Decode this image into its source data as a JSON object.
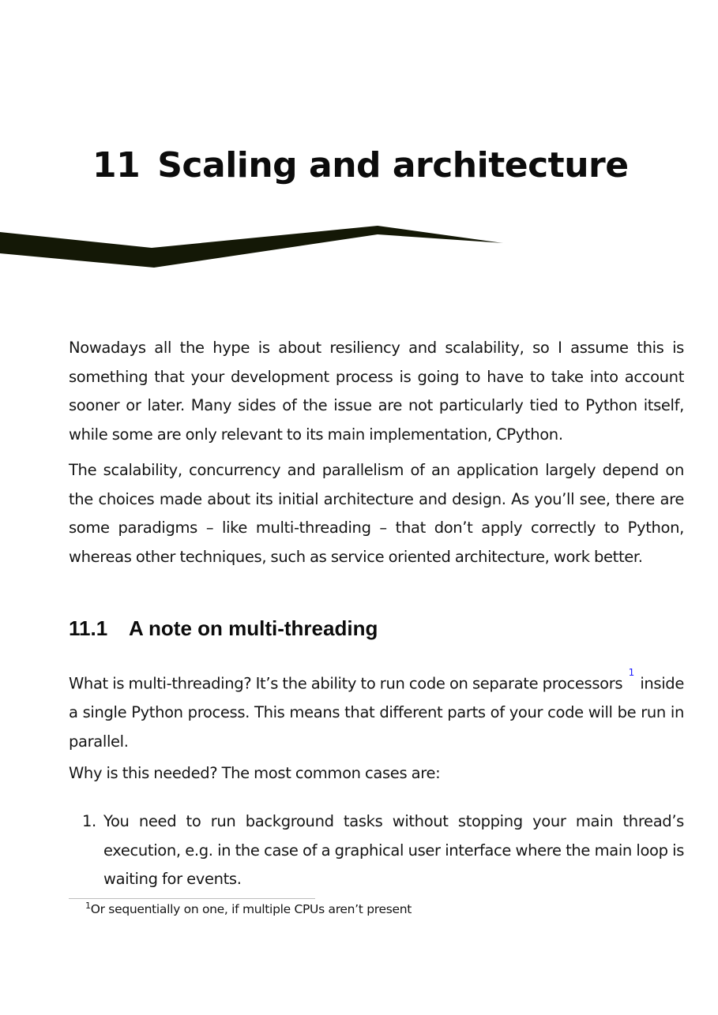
{
  "chapter": {
    "number": "11",
    "title": "Scaling and architecture"
  },
  "intro": {
    "p1": "Nowadays all the hype is about resiliency and scalability, so I assume this is something that your development process is going to have to take into account sooner or later. Many sides of the issue are not particularly tied to Python itself, while some are only relevant to its main implementation, CPython.",
    "p2": "The scalability, concurrency and parallelism of an application largely depend on the choices made about its initial architecture and design. As you’ll see, there are some paradigms – like multi-threading – that don’t apply correctly to Python, whereas other techniques, such as service oriented architecture, work better."
  },
  "section": {
    "number": "11.1",
    "title": "A note on multi-threading",
    "p1_before_ref": "What is multi-threading? It’s the ability to run code on separate processors",
    "p1_ref": "1",
    "p1_after_ref": "inside a single Python process. This means that different parts of your code will be run in parallel.",
    "p2": "Why is this needed? The most common cases are:",
    "list": [
      {
        "marker": "1.",
        "text": "You need to run background tasks without stopping your main thread’s execution, e.g. in the case of a graphical user interface where the main loop is waiting for events."
      }
    ]
  },
  "footnote": {
    "mark": "1",
    "text": "Or sequentially on one, if multiple CPUs aren’t present"
  },
  "colors": {
    "text": "#151515",
    "brush": "#141806",
    "footnote_ref": "#1a1aff"
  }
}
